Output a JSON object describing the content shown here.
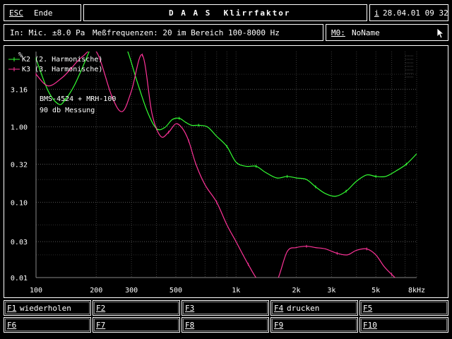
{
  "menu": {
    "esc_key": "ESC",
    "esc_label": "Ende",
    "title": "D A A S  Klirrfaktor",
    "info_key": "i",
    "datetime": "28.04.01 09 32"
  },
  "status": {
    "input_label": "In: Mic.",
    "level": "±8.0 Pa",
    "freq_label": "Meßfrequenzen: 20 im Bereich 100-8000 Hz",
    "memory_key": "M0:",
    "memory_name": "NoName",
    "cursor_icon": "mouse-pointer-icon"
  },
  "chart_data": {
    "type": "line",
    "xscale": "log",
    "yscale": "log",
    "xlim": [
      100,
      8000
    ],
    "ylim": [
      0.01,
      10
    ],
    "ylabel": "%",
    "x_ticks": [
      100,
      200,
      300,
      500,
      1000,
      2000,
      3000,
      5000,
      8000
    ],
    "x_tick_labels": [
      "100",
      "200",
      "300",
      "500",
      "1k",
      "2k",
      "3k",
      "5k",
      "8kHz"
    ],
    "y_ticks": [
      0.01,
      0.03,
      0.1,
      0.32,
      1.0,
      3.16
    ],
    "y_tick_labels": [
      "0.01",
      "0.03",
      "0.10",
      "0.32",
      "1.00",
      "3.16"
    ],
    "grid": true,
    "legend": "top-left",
    "annotations": [
      "BMS-4524 + MRH-100",
      "90 db Messung"
    ],
    "series": [
      {
        "name": "K2 (2. Harmonische)",
        "color": "#33ff33",
        "x": [
          100,
          115,
          130,
          140,
          155,
          170,
          190,
          210,
          240,
          280,
          320,
          360,
          400,
          440,
          480,
          520,
          560,
          600,
          650,
          720,
          800,
          900,
          1000,
          1120,
          1260,
          1400,
          1600,
          1800,
          2000,
          2250,
          2500,
          2800,
          3150,
          3550,
          4000,
          4500,
          5000,
          5600,
          6300,
          7100,
          8000
        ],
        "y": [
          8.0,
          3.0,
          2.0,
          2.3,
          3.5,
          6.0,
          12.0,
          20.0,
          20.0,
          12.0,
          4.0,
          1.6,
          0.95,
          0.98,
          1.25,
          1.3,
          1.15,
          1.05,
          1.05,
          1.0,
          0.75,
          0.55,
          0.34,
          0.3,
          0.3,
          0.25,
          0.21,
          0.22,
          0.21,
          0.2,
          0.16,
          0.13,
          0.12,
          0.14,
          0.19,
          0.23,
          0.22,
          0.22,
          0.26,
          0.32,
          0.44
        ]
      },
      {
        "name": "K3 (3. Harmonische)",
        "color": "#ff3399",
        "x": [
          100,
          115,
          135,
          150,
          170,
          200,
          240,
          270,
          300,
          340,
          380,
          420,
          460,
          500,
          540,
          580,
          630,
          700,
          800,
          900,
          1000,
          1150,
          1300,
          1450,
          1600,
          1800,
          2000,
          2250,
          2500,
          2800,
          3200,
          3600,
          4000,
          4500,
          5000,
          5500,
          6000,
          6500
        ],
        "y": [
          5.0,
          3.5,
          4.5,
          6.0,
          8.5,
          10.0,
          2.5,
          1.6,
          3.0,
          9.0,
          1.5,
          0.75,
          0.85,
          1.1,
          0.95,
          0.65,
          0.32,
          0.17,
          0.1,
          0.05,
          0.03,
          0.015,
          0.008,
          0.004,
          0.008,
          0.022,
          0.025,
          0.026,
          0.025,
          0.024,
          0.021,
          0.02,
          0.023,
          0.024,
          0.02,
          0.014,
          0.011,
          0.009
        ]
      }
    ]
  },
  "fkeys": [
    {
      "key": "F1",
      "label": "wiederholen"
    },
    {
      "key": "F2",
      "label": ""
    },
    {
      "key": "F3",
      "label": ""
    },
    {
      "key": "F4",
      "label": "drucken"
    },
    {
      "key": "F5",
      "label": ""
    },
    {
      "key": "F6",
      "label": ""
    },
    {
      "key": "F7",
      "label": ""
    },
    {
      "key": "F8",
      "label": ""
    },
    {
      "key": "F9",
      "label": ""
    },
    {
      "key": "F10",
      "label": ""
    }
  ]
}
